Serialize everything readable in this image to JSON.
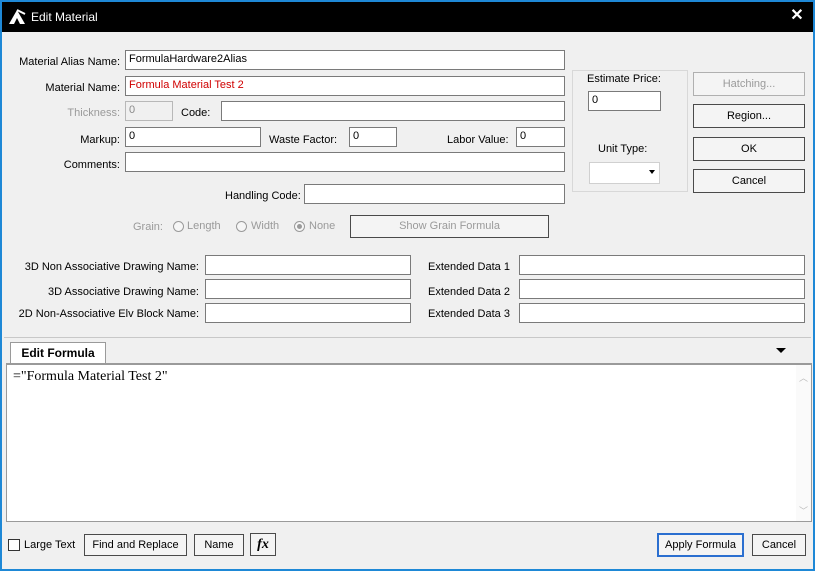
{
  "window": {
    "title": "Edit Material",
    "accent": "#1e88d6"
  },
  "fields": {
    "alias_label": "Material Alias Name:",
    "alias_value": "FormulaHardware2Alias",
    "name_label": "Material Name:",
    "name_value": "Formula Material Test 2",
    "thickness_label": "Thickness:",
    "thickness_value": "0",
    "code_label": "Code:",
    "code_value": "",
    "markup_label": "Markup:",
    "markup_value": "0",
    "waste_label": "Waste Factor:",
    "waste_value": "0",
    "labor_label": "Labor Value:",
    "labor_value": "0",
    "comments_label": "Comments:",
    "comments_value": "",
    "handling_label": "Handling Code:",
    "handling_value": ""
  },
  "price": {
    "estimate_label": "Estimate Price:",
    "estimate_value": "0",
    "unit_type_label": "Unit Type:",
    "unit_type_value": ""
  },
  "buttons": {
    "hatching": "Hatching...",
    "region": "Region...",
    "ok": "OK",
    "cancel": "Cancel"
  },
  "grain": {
    "label": "Grain:",
    "length": "Length",
    "width": "Width",
    "none": "None",
    "selected": "None",
    "formula_button": "Show Grain Formula"
  },
  "drawing": {
    "nonassoc_label": "3D Non Associative Drawing Name:",
    "nonassoc_value": "",
    "assoc_label": "3D Associative Drawing Name:",
    "assoc_value": "",
    "elv_label": "2D Non-Associative Elv Block Name:",
    "elv_value": "",
    "ext1_label": "Extended Data 1",
    "ext1_value": "",
    "ext2_label": "Extended Data 2",
    "ext2_value": "",
    "ext3_label": "Extended Data 3",
    "ext3_value": ""
  },
  "formula": {
    "tab_label": "Edit Formula",
    "content": "=\"Formula Material Test 2\""
  },
  "bottom": {
    "large_text_label": "Large Text",
    "find_replace": "Find and Replace",
    "name": "Name",
    "fx": "fx",
    "apply": "Apply Formula",
    "cancel": "Cancel"
  }
}
